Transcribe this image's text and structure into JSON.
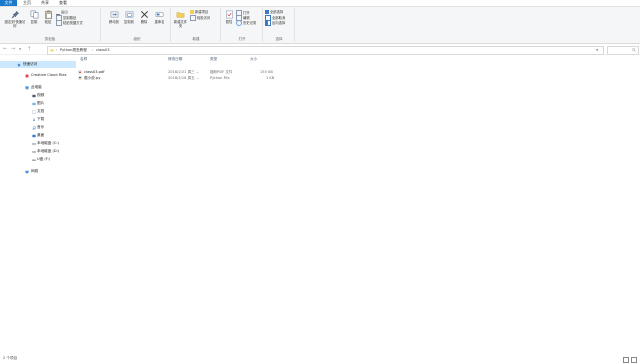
{
  "ribbon_tabs": [
    "文件",
    "主页",
    "共享",
    "查看"
  ],
  "ribbon": {
    "clipboard": {
      "pin_label": "固定到'快速访问'",
      "copy_label": "复制",
      "paste_label": "粘贴",
      "cut_label": "剪切",
      "copy_path_label": "复制路径",
      "paste_shortcut_label": "粘贴快捷方式",
      "group_label": "剪贴板"
    },
    "organize": {
      "move_to_label": "移动到",
      "copy_to_label": "复制到",
      "delete_label": "删除",
      "rename_label": "重命名",
      "group_label": "组织"
    },
    "new": {
      "new_folder_label": "新建文件夹",
      "new_item_label": "新建项目",
      "easy_access_label": "轻松访问",
      "group_label": "新建"
    },
    "open": {
      "properties_label": "属性",
      "open_label": "打开",
      "edit_label": "编辑",
      "history_label": "历史记录",
      "group_label": "打开"
    },
    "select": {
      "select_all_label": "全部选择",
      "select_none_label": "全部取消",
      "invert_label": "反向选择",
      "group_label": "选择"
    }
  },
  "address": {
    "crumbs": [
      "Python爬虫教程",
      "class03"
    ]
  },
  "nav": {
    "quick_access": "快速访问",
    "creative_cloud": "Creative Cloud Files",
    "this_pc": "此电脑",
    "items": [
      "视频",
      "图片",
      "文档",
      "下载",
      "音乐",
      "桌面",
      "本地磁盘 (C:)",
      "本地磁盘 (D:)",
      "U盘 (F:)"
    ],
    "network": "网络"
  },
  "list": {
    "columns": [
      "名称",
      "修改日期",
      "类型",
      "大小"
    ],
    "rows": [
      {
        "name": "class03.pdf",
        "date": "2018/2/21 周三 ...",
        "type": "福昕PDF 文件",
        "size": "155 KB",
        "icon_color": "#d9322b"
      },
      {
        "name": "爬小说.py",
        "date": "2018/2/16 周五 ...",
        "type": "Python File",
        "size": "1 KB",
        "icon_color": "#3572a5"
      }
    ]
  },
  "status": {
    "count": "2 个项目"
  },
  "colors": {
    "accent": "#1979ca",
    "selection": "#cce8ff"
  }
}
